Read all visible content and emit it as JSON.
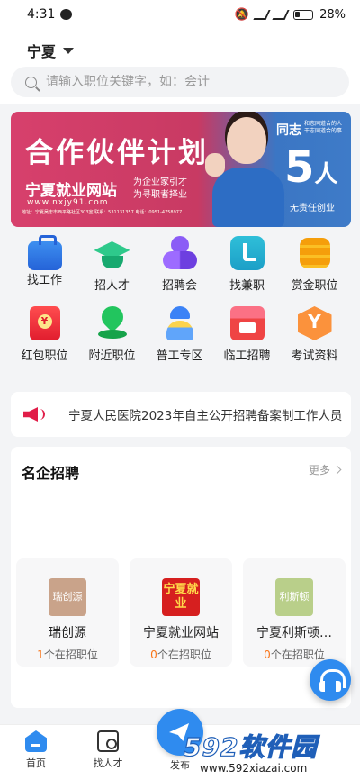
{
  "status_bar": {
    "time": "4:31",
    "battery": "28%"
  },
  "header": {
    "city": "宁夏"
  },
  "search": {
    "placeholder": "请输入职位关键字，如：会计"
  },
  "banner": {
    "title": "合作伙伴计划",
    "site_name": "宁夏就业网站",
    "domain": "www.nxjy91.com",
    "line1": "为企业家引才",
    "line2": "为寻职者择业",
    "address": "地址：宁夏吴忠市西平路社区303室  联系：531131357  电话：0951-4758977",
    "badge_top": "同志",
    "badge_top_small": "和志同道合的人 干志同道合的事",
    "badge_number": "5",
    "badge_unit": "人",
    "badge_bottom": "无责任创业"
  },
  "grid_items": [
    {
      "label": "找工作",
      "icon": "briefcase-icon"
    },
    {
      "label": "招人才",
      "icon": "graduation-cap-icon"
    },
    {
      "label": "招聘会",
      "icon": "people-icon"
    },
    {
      "label": "找兼职",
      "icon": "phone-icon"
    },
    {
      "label": "赏金职位",
      "icon": "coins-icon"
    },
    {
      "label": "红包职位",
      "icon": "red-envelope-icon"
    },
    {
      "label": "附近职位",
      "icon": "location-pin-icon"
    },
    {
      "label": "普工专区",
      "icon": "worker-icon"
    },
    {
      "label": "临工招聘",
      "icon": "shop-icon"
    },
    {
      "label": "考试资料",
      "icon": "hexagon-icon"
    }
  ],
  "notice": {
    "text": "宁夏人民医院2023年自主公开招聘备案制工作人员"
  },
  "companies": {
    "title": "名企招聘",
    "more": "更多",
    "items": [
      {
        "logo": "瑞创源",
        "name": "瑞创源",
        "count": "1",
        "suffix": "个在招职位",
        "color": "#c9a38a"
      },
      {
        "logo": "宁夏就业",
        "name": "宁夏就业网站",
        "count": "0",
        "suffix": "个在招职位",
        "color": "#d61f1f"
      },
      {
        "logo": "利斯顿",
        "name": "宁夏利斯顿…",
        "count": "0",
        "suffix": "个在招职位",
        "color": "#b9cf8a"
      }
    ]
  },
  "tabbar": {
    "home": "首页",
    "talent": "找人才",
    "publish": "发布"
  },
  "watermark": {
    "big": "592软件园",
    "small": "www.592xiazai.com"
  }
}
